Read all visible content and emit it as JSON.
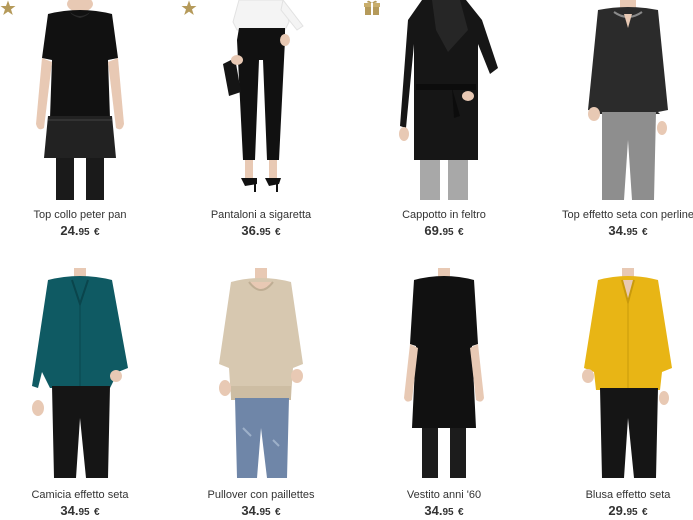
{
  "products": [
    {
      "name": "Top collo peter pan",
      "price_int": "24.",
      "price_dec": "95",
      "currency": "€",
      "badge": "star-icon"
    },
    {
      "name": "Pantaloni a sigaretta",
      "price_int": "36.",
      "price_dec": "95",
      "currency": "€",
      "badge": "star-icon"
    },
    {
      "name": "Cappotto in feltro",
      "price_int": "69.",
      "price_dec": "95",
      "currency": "€",
      "badge": "gift-icon"
    },
    {
      "name": "Top effetto seta con perline",
      "price_int": "34.",
      "price_dec": "95",
      "currency": "€",
      "badge": ""
    },
    {
      "name": "Camicia effetto seta",
      "price_int": "34.",
      "price_dec": "95",
      "currency": "€",
      "badge": ""
    },
    {
      "name": "Pullover con paillettes",
      "price_int": "34.",
      "price_dec": "95",
      "currency": "€",
      "badge": ""
    },
    {
      "name": "Vestito anni '60",
      "price_int": "34.",
      "price_dec": "95",
      "currency": "€",
      "badge": ""
    },
    {
      "name": "Blusa effetto seta",
      "price_int": "29.",
      "price_dec": "95",
      "currency": "€",
      "badge": ""
    }
  ],
  "colors": {
    "badge_gold": "#b59a5a",
    "text": "#333333"
  }
}
